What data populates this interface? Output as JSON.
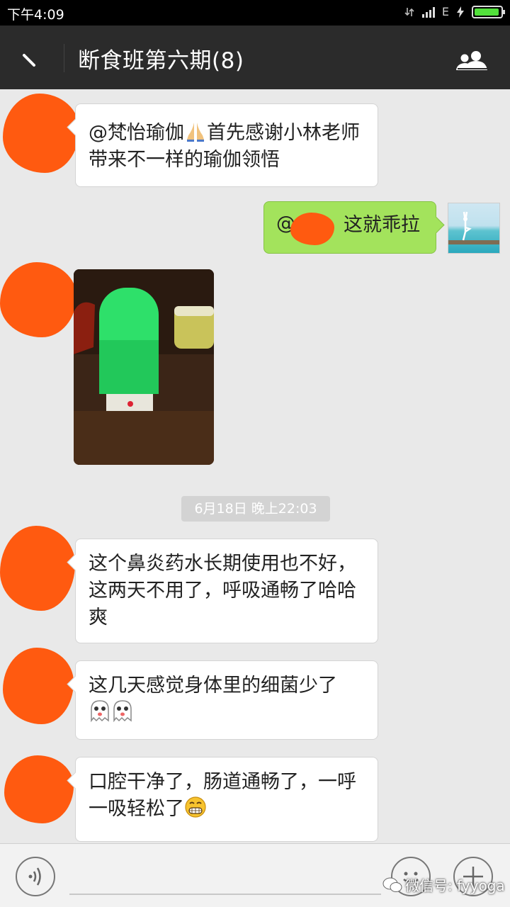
{
  "status_bar": {
    "time": "下午4:09",
    "network": "E"
  },
  "header": {
    "title": "断食班第六期(8)"
  },
  "messages": [
    {
      "from": "other",
      "text_before": "@梵怡瑜伽",
      "emoji": "praying-hands",
      "text_after": "首先感谢小林老师带来不一样的瑜伽领悟"
    },
    {
      "from": "me",
      "text": "这就乖拉",
      "mention_prefix": "@"
    },
    {
      "from": "other",
      "type": "image",
      "description": "photo"
    },
    {
      "from": "other",
      "text": "这个鼻炎药水长期使用也不好，这两天不用了，呼吸通畅了哈哈爽"
    },
    {
      "from": "other",
      "text": "这几天感觉身体里的细菌少了",
      "emoji": "ghost x2"
    },
    {
      "from": "other",
      "text": "口腔干净了，肠道通畅了，一呼一吸轻松了",
      "emoji": "grinning-face"
    }
  ],
  "timestamp": "6月18日 晚上22:03",
  "watermark": "微信号: fyyoga",
  "colors": {
    "mine_bubble": "#a3e35c",
    "other_bubble": "#ffffff",
    "redaction": "#ff5a10",
    "header_bg": "#2b2b2b"
  },
  "icons": [
    "back-icon",
    "group-icon",
    "voice-icon",
    "emoji-icon",
    "plus-icon",
    "wechat-icon"
  ]
}
